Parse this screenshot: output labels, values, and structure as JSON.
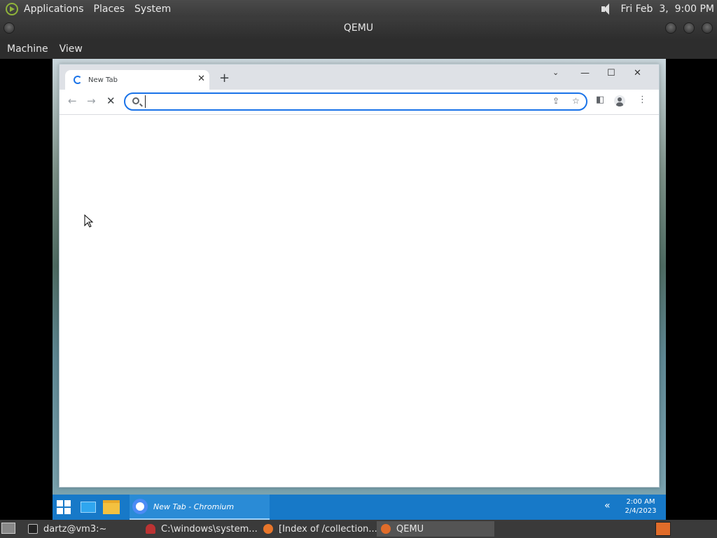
{
  "host": {
    "menu": {
      "applications": "Applications",
      "places": "Places",
      "system": "System"
    },
    "clock": "Fri Feb  3,  9:00 PM",
    "window_title": "QEMU",
    "qemu_menu": {
      "machine": "Machine",
      "view": "View"
    }
  },
  "browser": {
    "tab_title": "New Tab",
    "omnibox": {
      "value": "",
      "placeholder": ""
    }
  },
  "guest_taskbar": {
    "chromium_label": "New Tab - Chromium",
    "time": "2:00 AM",
    "date": "2/4/2023"
  },
  "host_taskbar": {
    "items": [
      {
        "label": "dartz@vm3:~"
      },
      {
        "label": "C:\\windows\\system..."
      },
      {
        "label": "[Index of /collection..."
      },
      {
        "label": "QEMU"
      }
    ]
  }
}
